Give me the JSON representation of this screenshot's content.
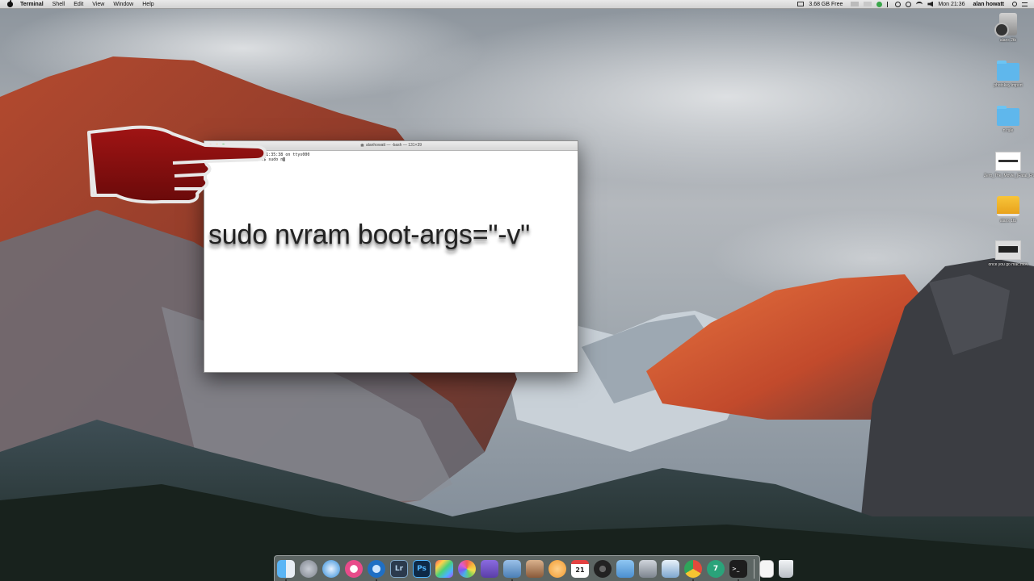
{
  "menubar": {
    "app_name": "Terminal",
    "menus": [
      "Shell",
      "Edit",
      "View",
      "Window",
      "Help"
    ],
    "disk_free": "3.68 GB Free",
    "clock": "Mon 21:36",
    "user": "alan howatt"
  },
  "desktop": {
    "icons": [
      {
        "label": "alans 2tb",
        "icon": "external-drive-icon"
      },
      {
        "label": "photokey import",
        "icon": "folder-icon"
      },
      {
        "label": "n rule",
        "icon": "folder-icon"
      },
      {
        "label": "Zero_The_Movie_(Fatal_Fra...d5).mp4",
        "icon": "video-file-icon"
      },
      {
        "label": "alans 1tb",
        "icon": "external-drive-icon"
      },
      {
        "label": "once you go mac.mov",
        "icon": "video-file-icon"
      }
    ]
  },
  "terminal": {
    "title": "alanhowatt — -bash — 131×39",
    "line1": "Last login: Mon Nov 21 21:35:38 on ttys000",
    "line2": "Alans-iMac:~ alanhowatt$ sudo n"
  },
  "overlay": {
    "command": "sudo nvram boot-args=\"-v\""
  },
  "dock": {
    "items": [
      {
        "name": "finder",
        "color": "#3d8fe0"
      },
      {
        "name": "launchpad",
        "color": "#8a8f99"
      },
      {
        "name": "safari",
        "color": "#2f8bd8"
      },
      {
        "name": "itunes",
        "color": "#e84b8a"
      },
      {
        "name": "quicktime",
        "color": "#1f6fc4"
      },
      {
        "name": "lightroom",
        "color": "#2b3a4d",
        "text": "Lr"
      },
      {
        "name": "photoshop",
        "color": "#0e2a47",
        "text": "Ps"
      },
      {
        "name": "final-cut",
        "color": "#2a2a2a"
      },
      {
        "name": "photos",
        "color": "#f2f2f2"
      },
      {
        "name": "imovie",
        "color": "#6a4bb8"
      },
      {
        "name": "preview",
        "color": "#4b7fb5"
      },
      {
        "name": "photo-app",
        "color": "#b87a4a"
      },
      {
        "name": "orange-app",
        "color": "#f29a2e"
      },
      {
        "name": "calendar",
        "color": "#ffffff",
        "text": "21"
      },
      {
        "name": "dvd-app",
        "color": "#333333"
      },
      {
        "name": "finder-folder",
        "color": "#6aa7e0"
      },
      {
        "name": "system-app",
        "color": "#9aa2ad"
      },
      {
        "name": "preview-2",
        "color": "#a7c4e0"
      },
      {
        "name": "chrome",
        "color": "#e8e8e8"
      },
      {
        "name": "app-7",
        "color": "#2aa37a",
        "text": "7"
      },
      {
        "name": "terminal",
        "color": "#1d1d1d"
      },
      {
        "name": "document",
        "color": "#f5f5f5"
      },
      {
        "name": "trash",
        "color": "#d9dde2"
      }
    ]
  }
}
